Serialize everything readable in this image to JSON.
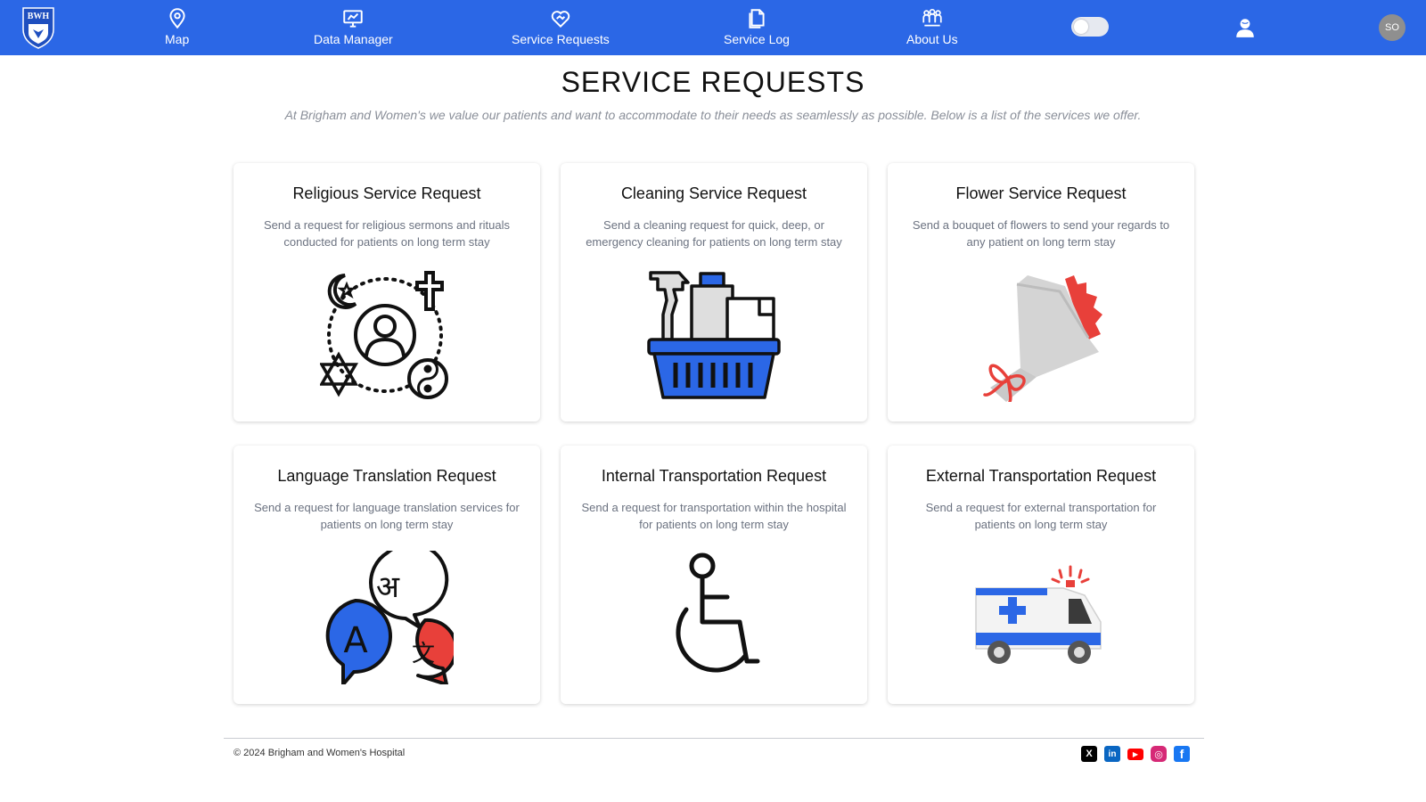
{
  "brand": {
    "logo_text": "BWH",
    "colors": {
      "primary": "#2b67e6",
      "accent_red": "#e8403a",
      "icon_blue": "#2b67e6"
    }
  },
  "nav": {
    "items": [
      {
        "label": "Map",
        "icon": "map-pin-icon"
      },
      {
        "label": "Data Manager",
        "icon": "presentation-chart-icon"
      },
      {
        "label": "Service Requests",
        "icon": "heart-handshake-icon"
      },
      {
        "label": "Service Log",
        "icon": "documents-icon"
      },
      {
        "label": "About Us",
        "icon": "team-icon"
      }
    ],
    "avatar_initials": "SO"
  },
  "page": {
    "title": "SERVICE REQUESTS",
    "subtitle": "At Brigham and Women's we value our patients and want to accommodate to their needs as seamlessly as possible. Below is a list of the services we offer."
  },
  "cards": [
    {
      "title": "Religious Service Request",
      "description": "Send a request for religious sermons and rituals conducted for patients on long term stay",
      "icon": "religion-icon"
    },
    {
      "title": "Cleaning Service Request",
      "description": "Send a cleaning request for quick, deep, or emergency cleaning for patients on long term stay",
      "icon": "cleaning-basket-icon"
    },
    {
      "title": "Flower Service Request",
      "description": "Send a bouquet of flowers to send your regards to any patient on long term stay",
      "icon": "flower-bouquet-icon"
    },
    {
      "title": "Language Translation Request",
      "description": "Send a request for language translation services for patients on long term stay",
      "icon": "translation-bubbles-icon",
      "glyphs": [
        "अ",
        "A",
        "文"
      ]
    },
    {
      "title": "Internal Transportation Request",
      "description": "Send a request for transportation within the hospital for patients on long term stay",
      "icon": "wheelchair-icon"
    },
    {
      "title": "External Transportation Request",
      "description": "Send a request for external transportation for patients on long term stay",
      "icon": "ambulance-icon"
    }
  ],
  "footer": {
    "copyright": "© 2024 Brigham and Women's Hospital",
    "social": [
      {
        "name": "x-icon",
        "glyph": "X"
      },
      {
        "name": "linkedin-icon",
        "glyph": "in"
      },
      {
        "name": "youtube-icon",
        "glyph": "▶"
      },
      {
        "name": "instagram-icon",
        "glyph": "◎"
      },
      {
        "name": "facebook-icon",
        "glyph": "f"
      }
    ]
  }
}
